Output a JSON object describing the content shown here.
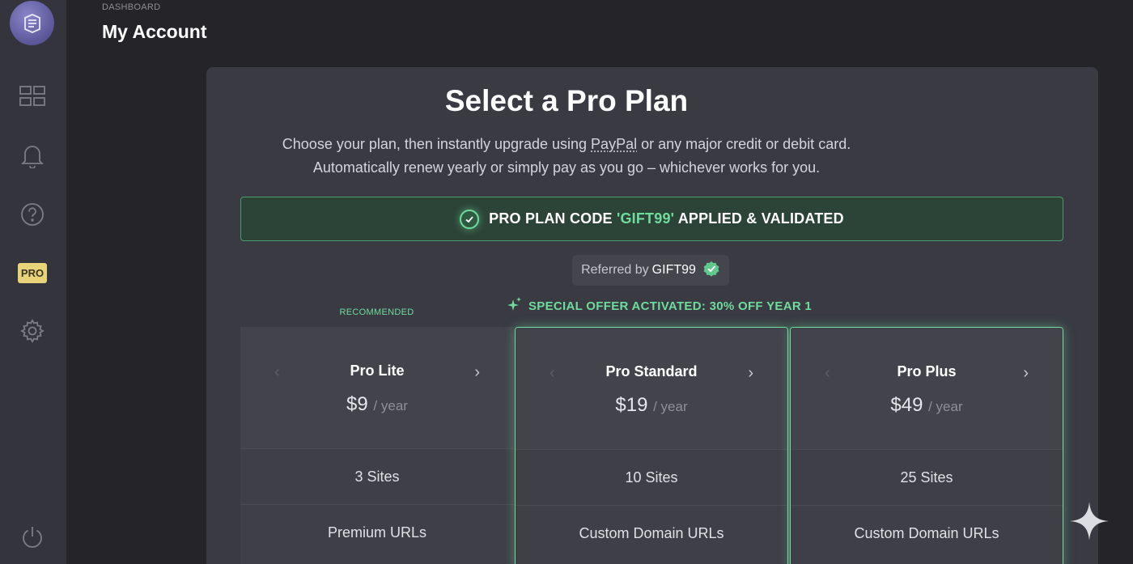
{
  "header": {
    "breadcrumb": "DASHBOARD",
    "title": "My Account"
  },
  "sidebar": {
    "icons": [
      "logo-icon",
      "dashboard-grid-icon",
      "bell-icon",
      "help-icon",
      "pro-badge",
      "gear-icon",
      "power-icon"
    ],
    "pro_label": "PRO"
  },
  "main": {
    "heading": "Select a Pro Plan",
    "subtitle_line1_a": "Choose your plan, then instantly upgrade using ",
    "subtitle_paypal": "PayPal",
    "subtitle_line1_b": " or any major credit or debit card.",
    "subtitle_line2": "Automatically renew yearly or simply pay as you go – whichever works for you.",
    "banner": {
      "prefix": "PRO PLAN CODE ",
      "code": "'GIFT99'",
      "suffix": " APPLIED & VALIDATED"
    },
    "referred": {
      "label": "Referred by",
      "code": "GIFT99"
    },
    "recommended": "RECOMMENDED",
    "offer": "SPECIAL OFFER ACTIVATED: 30% OFF YEAR 1",
    "plans": [
      {
        "name": "Pro Lite",
        "price": "$9",
        "period": "/ year",
        "features": [
          "3 Sites",
          "Premium URLs"
        ]
      },
      {
        "name": "Pro Standard",
        "price": "$19",
        "period": "/ year",
        "features": [
          "10 Sites",
          "Custom Domain URLs"
        ]
      },
      {
        "name": "Pro Plus",
        "price": "$49",
        "period": "/ year",
        "features": [
          "25 Sites",
          "Custom Domain URLs"
        ]
      }
    ]
  },
  "colors": {
    "accent_green": "#6fdc9d",
    "pro_badge": "#e8d27a",
    "panel": "#393a42"
  }
}
